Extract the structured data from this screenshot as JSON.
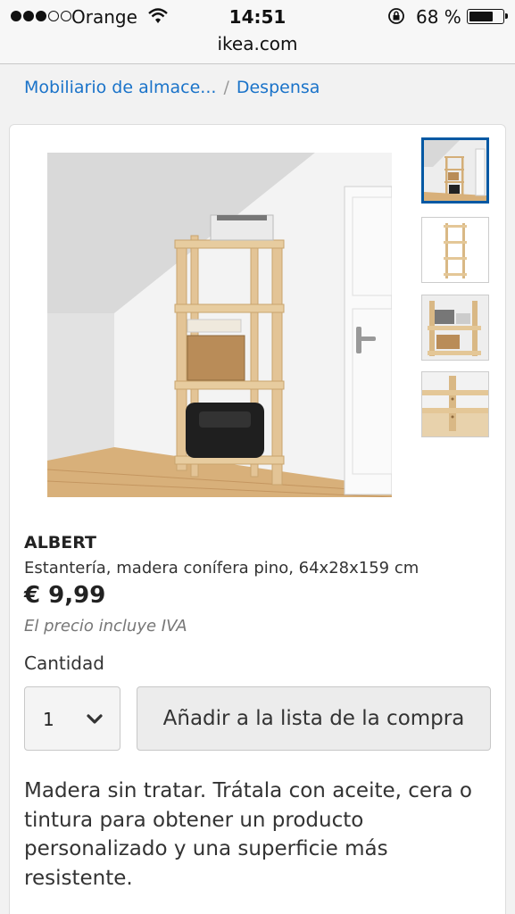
{
  "status_bar": {
    "carrier": "Orange",
    "time": "14:51",
    "battery_percent": "68 %",
    "signal_bars_filled": 3,
    "signal_bars_total": 5,
    "battery_level": 0.68
  },
  "url_bar": {
    "url": "ikea.com"
  },
  "breadcrumb": {
    "items": [
      {
        "label": "Mobiliario de almace..."
      },
      {
        "label": "Despensa"
      }
    ],
    "separator": "/"
  },
  "product": {
    "name": "ALBERT",
    "description": "Estantería, madera conífera pino, 64x28x159 cm",
    "price": "€ 9,99",
    "price_note": "El precio incluye IVA",
    "quantity_label": "Cantidad",
    "quantity_value": "1",
    "add_button_label": "Añadir a la lista de la compra",
    "care_text": "Madera sin tratar. Trátala con aceite, cera o tintura para obtener un producto personalizado y una superficie más resistente."
  },
  "colors": {
    "link": "#1a73c9",
    "thumb_selected_border": "#0058a3",
    "wood": "#e3c496"
  },
  "thumbnails": [
    {
      "icon": "room-view-thumbnail",
      "selected": true
    },
    {
      "icon": "shelf-only-thumbnail",
      "selected": false
    },
    {
      "icon": "shelf-closeup-thumbnail",
      "selected": false
    },
    {
      "icon": "shelf-detail-thumbnail",
      "selected": false
    }
  ]
}
